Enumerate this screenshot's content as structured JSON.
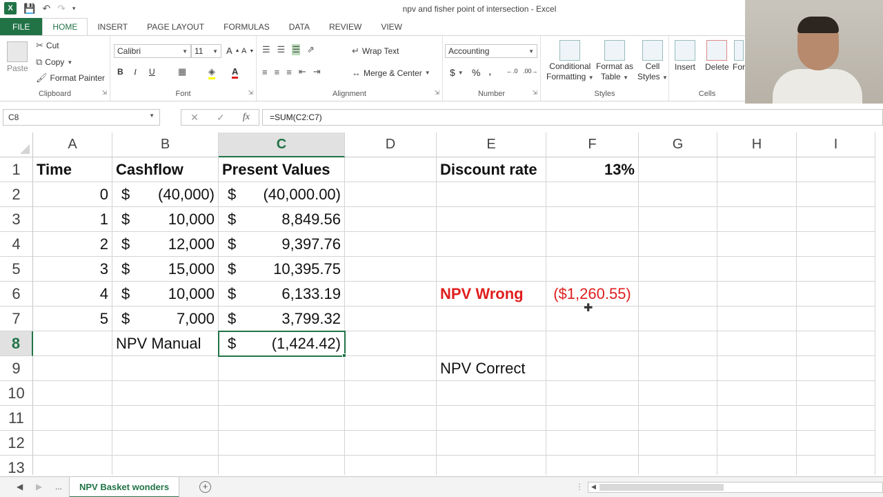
{
  "window": {
    "title": "npv and fisher point of intersection - Excel"
  },
  "tabs": [
    "FILE",
    "HOME",
    "INSERT",
    "PAGE LAYOUT",
    "FORMULAS",
    "DATA",
    "REVIEW",
    "VIEW"
  ],
  "ribbon": {
    "clipboard": {
      "paste": "Paste",
      "cut": "Cut",
      "copy": "Copy",
      "format_painter": "Format Painter",
      "label": "Clipboard"
    },
    "font": {
      "name": "Calibri",
      "size": "11",
      "bold": "B",
      "italic": "I",
      "underline": "U",
      "label": "Font"
    },
    "alignment": {
      "wrap_text": "Wrap Text",
      "merge_center": "Merge & Center",
      "label": "Alignment"
    },
    "number": {
      "format": "Accounting",
      "currency": "$",
      "percent": "%",
      "comma": ",",
      "label": "Number"
    },
    "styles": {
      "conditional": "Conditional",
      "formatting": "Formatting",
      "format_as": "Format as",
      "table": "Table",
      "cell": "Cell",
      "styles": "Styles",
      "label": "Styles"
    },
    "cells": {
      "insert": "Insert",
      "delete": "Delete",
      "format": "For",
      "label": "Cells"
    }
  },
  "formula_bar": {
    "name_box": "C8",
    "formula": "=SUM(C2:C7)",
    "fx": "fx",
    "cancel": "✕",
    "enter": "✓"
  },
  "grid": {
    "columns": [
      "A",
      "B",
      "C",
      "D",
      "E",
      "F",
      "G",
      "H",
      "I"
    ],
    "rows": [
      "1",
      "2",
      "3",
      "4",
      "5",
      "6",
      "7",
      "8",
      "9",
      "10",
      "11",
      "12",
      "13"
    ],
    "cells": {
      "A1": "Time",
      "B1": "Cashflow",
      "C1": "Present Values",
      "E1": "Discount rate",
      "F1": "13%",
      "A2": "0",
      "B2": "(40,000)",
      "C2": "(40,000.00)",
      "A3": "1",
      "B3": "10,000",
      "C3": "8,849.56",
      "A4": "2",
      "B4": "12,000",
      "C4": "9,397.76",
      "A5": "3",
      "B5": "15,000",
      "C5": "10,395.75",
      "A6": "4",
      "B6": "10,000",
      "C6": "6,133.19",
      "E6": "NPV Wrong",
      "F6": "($1,260.55)",
      "A7": "5",
      "B7": "7,000",
      "C7": "3,799.32",
      "B8": "NPV Manual",
      "C8": "(1,424.42)",
      "E9": "NPV Correct"
    },
    "currency_symbol": "$",
    "accent_color": "#217346",
    "error_color": "#e01e1e"
  },
  "sheets": {
    "more": "...",
    "active": "NPV Basket wonders",
    "add": "+"
  }
}
